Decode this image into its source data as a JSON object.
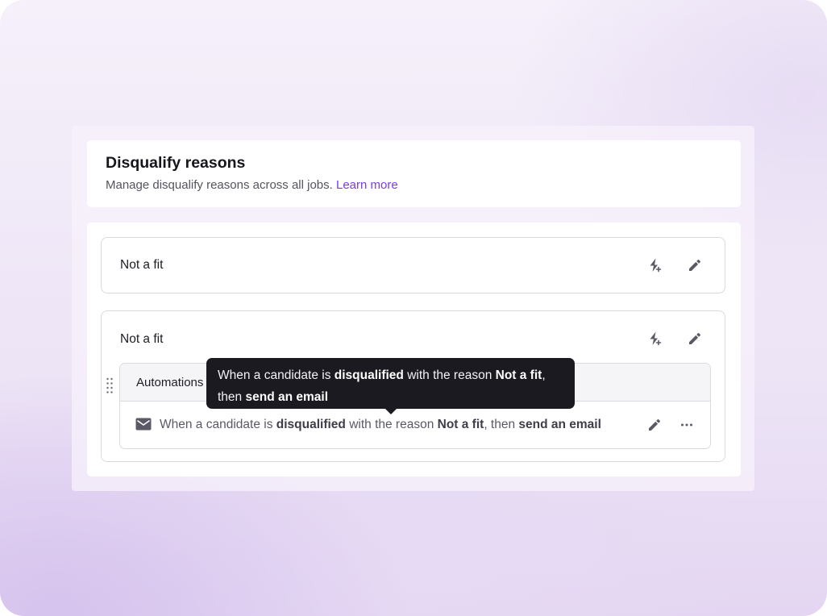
{
  "header": {
    "title": "Disqualify reasons",
    "subtitle": "Manage disqualify reasons across all jobs.",
    "learn_more": "Learn more"
  },
  "reasons": [
    {
      "name": "Not a fit"
    },
    {
      "name": "Not a fit"
    }
  ],
  "automations": {
    "label": "Automations",
    "row": {
      "icon": "mail-icon",
      "t1": "When a candidate is ",
      "b1": "disqualified",
      "t2": " with the reason ",
      "b2": "Not a fit",
      "t3": ", then ",
      "b3": "send an email"
    }
  },
  "tooltip": {
    "t1": "When a candidate is ",
    "b1": "disqualified",
    "t2": " with the reason ",
    "b2": "Not a fit",
    "t3": ", then ",
    "b3": "send an email"
  },
  "colors": {
    "accent": "#7c3aed",
    "tooltip_bg": "#1b1a21",
    "icon": "#5b5966"
  }
}
